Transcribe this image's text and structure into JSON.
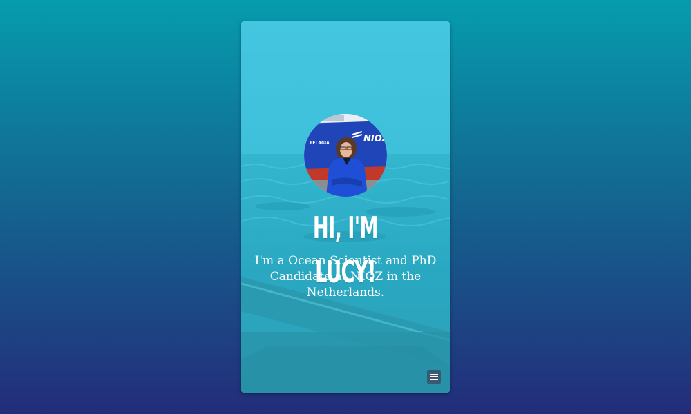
{
  "hero": {
    "title": "HI, I'M LUCY!",
    "subtitle": "I'm a Ocean Scientist and PhD Candidate at NIOZ in the Netherlands."
  },
  "avatar": {
    "ship_name": "PELAGIA",
    "ship_logo": "NIOZ"
  },
  "menu": {
    "icon": "hamburger-menu-icon"
  },
  "colors": {
    "background_top": "#069cae",
    "background_bottom": "#232c7a",
    "card_tint": "#3fc0d8",
    "menu_button": "#3a5a73"
  }
}
